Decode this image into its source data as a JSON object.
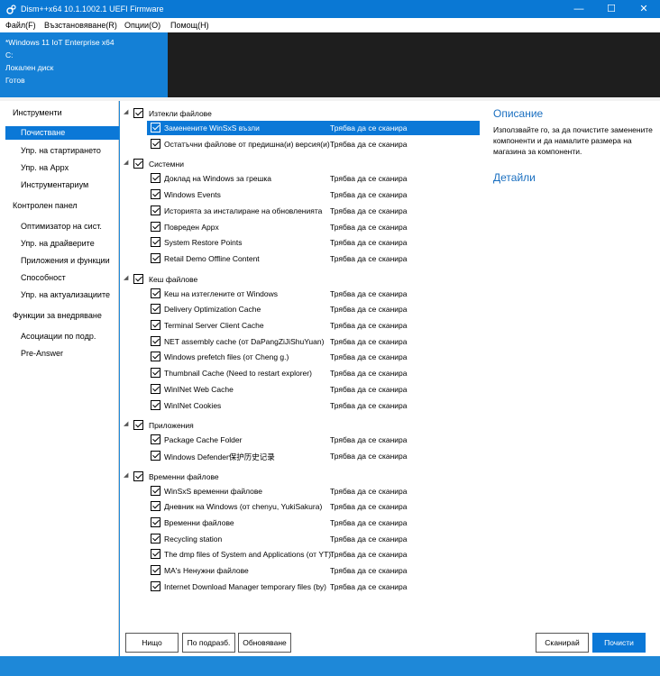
{
  "window": {
    "title": "Dism++x64 10.1.1002.1 UEFI Firmware",
    "minimize": "—",
    "maximize": "☐",
    "close": "✕"
  },
  "menu": [
    "Файл(F)",
    "Възстановяване(R)",
    "Опции(O)",
    "Помощ(H)"
  ],
  "system_info": {
    "os": "*Windows 11 IoT Enterprise x64",
    "drive": "C:",
    "disk": "Локален диск",
    "state": "Готов"
  },
  "sidebar": {
    "tools_header": "Инструменти",
    "tools": [
      "Почистване",
      "Упр. на стартирането",
      "Упр. на Appx",
      "Инструментариум"
    ],
    "control_header": "Контролен панел",
    "control": [
      "Оптимизатор на сист.",
      "Упр. на драйверите",
      "Приложения и функции",
      "Способност",
      "Упр. на актуализациите"
    ],
    "deploy_header": "Функции за внедряване",
    "deploy": [
      "Асоциации по подр.",
      "Pre-Answer"
    ]
  },
  "status_default": "Трябва да се сканира",
  "groups": [
    {
      "title": "Изтекли файлове",
      "items": [
        "Заменените WinSxS възли",
        "Остатъчни файлове от предишна(и) версия(и)"
      ]
    },
    {
      "title": "Системни",
      "items": [
        "Доклад на Windows за грешка",
        "Windows Events",
        "Историята за инсталиране на обновленията",
        "Повреден Appx",
        "System Restore Points",
        "Retail Demo Offline Content"
      ]
    },
    {
      "title": "Кеш файлове",
      "items": [
        "Кеш на изтеглените от Windows",
        "Delivery Optimization Cache",
        "Terminal Server Client Cache",
        "NET assembly cache (от DaPangZiJiShuYuan)",
        "Windows prefetch files (от Cheng g.)",
        "Thumbnail Cache (Need to restart explorer)",
        "WinINet Web Cache",
        "WinINet Cookies"
      ]
    },
    {
      "title": "Приложения",
      "items": [
        "Package Cache Folder",
        "Windows Defender保护历史记录"
      ]
    },
    {
      "title": "Временни файлове",
      "items": [
        "WinSxS временни файлове",
        "Дневник на Windows (от chenyu, YukiSakura)",
        "Временни файлове",
        "Recycling station",
        "The dmp files of System and Applications (от YT)",
        "MA's Ненужни файлове",
        "Internet Download Manager temporary files (by)"
      ]
    }
  ],
  "description": {
    "title": "Описание",
    "text": "Използвайте го, за да почистите заменените компоненти и да намалите размера на магазина за компоненти.",
    "details": "Детайли"
  },
  "buttons": {
    "none": "Нищо",
    "default": "По подразб.",
    "refresh": "Обновяване",
    "scan": "Сканирай",
    "clean": "Почисти"
  },
  "colors": {
    "accent": "#0b78d7",
    "title_bar": "#0a78d4",
    "info_panel": "#1480d6",
    "dark_panel": "#1e1e1e",
    "link": "#1a6fc0"
  }
}
